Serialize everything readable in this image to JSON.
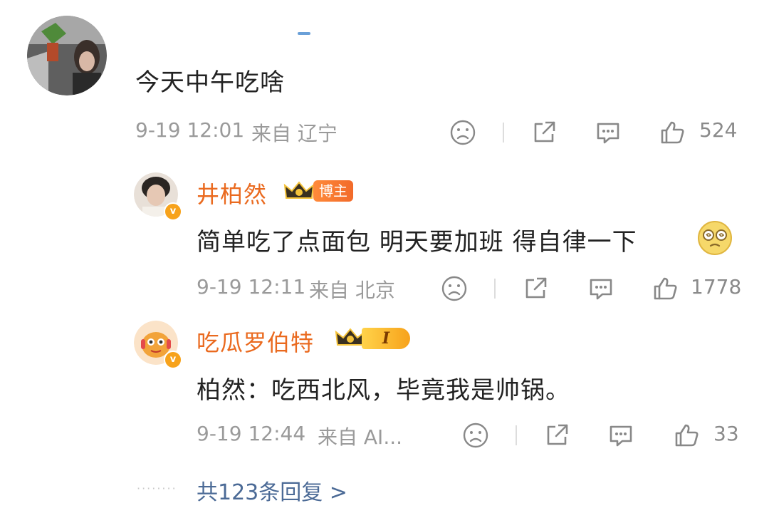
{
  "main_comment": {
    "text": "今天中午吃啥",
    "time": "9-19 12:01",
    "location": "来自 辽宁",
    "like_count": "524",
    "icons": [
      "dislike-face-icon",
      "share-icon",
      "comment-icon",
      "like-icon"
    ]
  },
  "replies": [
    {
      "username": "井柏然",
      "badge": "博主",
      "text": "简单吃了点面包 明天要加班 得自律一下",
      "emoji": "dizzy-face-emoji",
      "time": "9-19 12:11",
      "location": "来自 北京",
      "like_count": "1778",
      "verified_icon": "v"
    },
    {
      "username": "吃瓜罗伯特",
      "level": "I",
      "text": "柏然：吃西北风，毕竟我是帅锅。",
      "time": "9-19 12:44",
      "location": "来自 AI...",
      "like_count": "33",
      "verified_icon": "v"
    }
  ],
  "more_replies": {
    "dots": "········",
    "label": "共123条回复 >"
  },
  "colors": {
    "username": "#ea6a1f",
    "meta": "#9a9a9a",
    "link": "#4b6a96",
    "badge": "#f26a2a",
    "verified": "#f7a21b"
  }
}
